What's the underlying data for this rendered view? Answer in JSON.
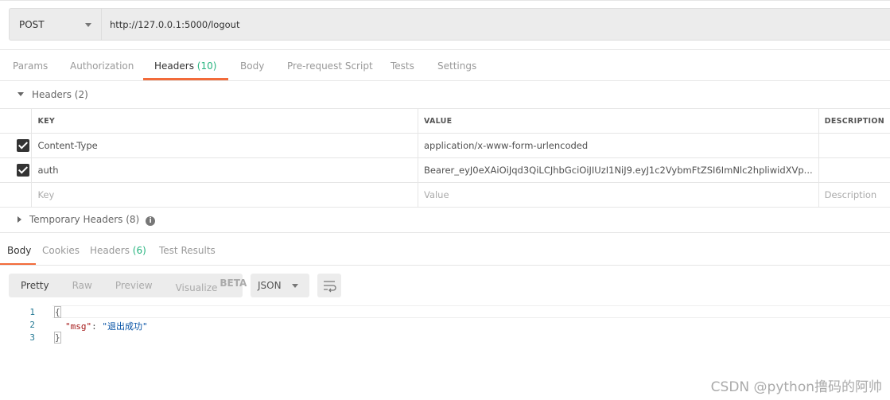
{
  "request": {
    "method": "POST",
    "url": "http://127.0.0.1:5000/logout"
  },
  "request_tabs": [
    {
      "label": "Params"
    },
    {
      "label": "Authorization"
    },
    {
      "label": "Headers",
      "count": "(10)"
    },
    {
      "label": "Body"
    },
    {
      "label": "Pre-request Script"
    },
    {
      "label": "Tests"
    },
    {
      "label": "Settings"
    }
  ],
  "headers_section": {
    "title": "Headers (2)",
    "columns": [
      "KEY",
      "VALUE",
      "DESCRIPTION"
    ],
    "rows": [
      {
        "checked": true,
        "key": "Content-Type",
        "value": "application/x-www-form-urlencoded",
        "description": ""
      },
      {
        "checked": true,
        "key": "auth",
        "value": "Bearer_eyJ0eXAiOiJqd3QiLCJhbGciOiJIUzI1NiJ9.eyJ1c2VybmFtZSI6ImNlc2hpliwidXVp...",
        "description": ""
      }
    ],
    "placeholders": {
      "key": "Key",
      "value": "Value",
      "description": "Description"
    }
  },
  "temporary_headers": "Temporary Headers (8)",
  "response_tabs": [
    {
      "label": "Body"
    },
    {
      "label": "Cookies"
    },
    {
      "label": "Headers",
      "count": "(6)"
    },
    {
      "label": "Test Results"
    }
  ],
  "view_modes": {
    "pretty": "Pretty",
    "raw": "Raw",
    "preview": "Preview",
    "visualize": "Visualize",
    "beta": "BETA"
  },
  "format": "JSON",
  "code": {
    "lines": [
      "1",
      "2",
      "3"
    ],
    "open": "{",
    "key": "\"msg\"",
    "colon": ": ",
    "value": "\"退出成功\"",
    "close": "}"
  },
  "watermark": "CSDN @python撸码的阿帅",
  "colors": {
    "accent": "#f26b3a",
    "count": "#26b47f"
  }
}
